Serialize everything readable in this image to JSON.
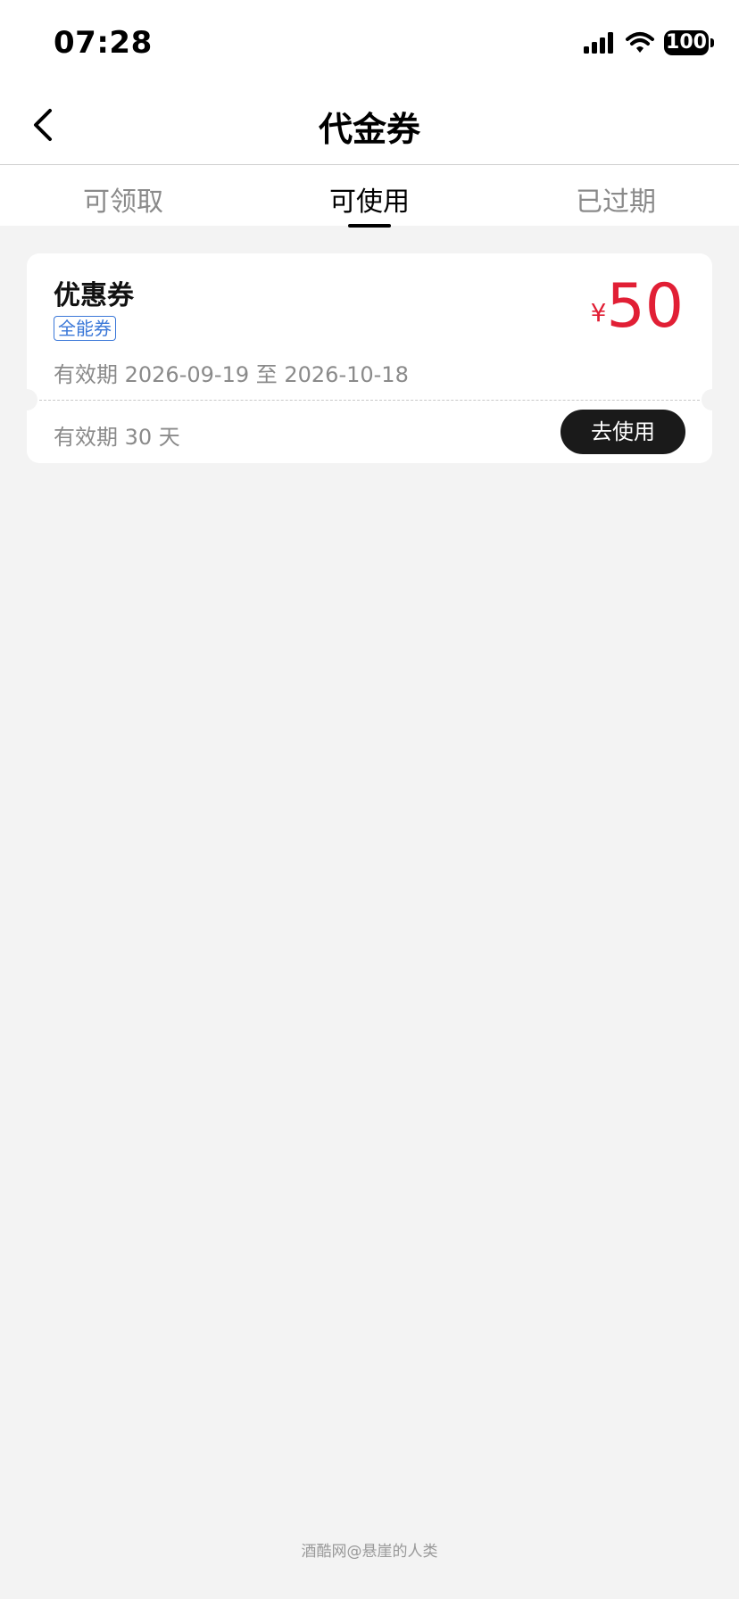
{
  "status_bar": {
    "time": "07:28",
    "battery": "100",
    "icons": [
      "signal-icon",
      "wifi-icon",
      "battery-icon"
    ]
  },
  "nav": {
    "title": "代金券",
    "back_icon": "chevron-left-icon"
  },
  "tabs": [
    {
      "label": "可领取",
      "active": false
    },
    {
      "label": "可使用",
      "active": true
    },
    {
      "label": "已过期",
      "active": false
    }
  ],
  "coupon": {
    "name": "优惠券",
    "badge": "全能券",
    "validity_range": "有效期 2026-09-19 至 2026-10-18",
    "currency": "¥",
    "amount": "50",
    "validity_days": "有效期 30 天",
    "action_label": "去使用"
  },
  "watermark": "酒酷网@悬崖的人类",
  "colors": {
    "accent_red": "#e11f35",
    "badge_blue": "#3b78d8",
    "button_dark": "#1a1a1a",
    "background": "#f3f3f3"
  }
}
